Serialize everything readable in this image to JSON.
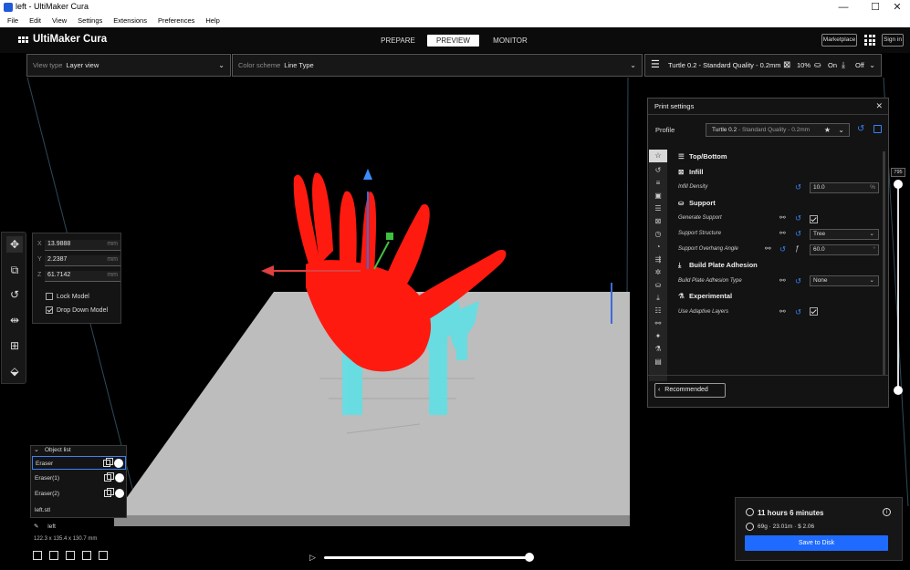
{
  "window": {
    "title": "left - UltiMaker Cura",
    "minimize": "—",
    "maximize": "☐",
    "close": "✕"
  },
  "menu": [
    "File",
    "Edit",
    "View",
    "Settings",
    "Extensions",
    "Preferences",
    "Help"
  ],
  "header": {
    "logo": "UltiMaker Cura",
    "stages": [
      "PREPARE",
      "PREVIEW",
      "MONITOR"
    ],
    "active_stage": "PREVIEW",
    "marketplace": "Marketplace",
    "signin": "Sign in"
  },
  "view_toolbar": {
    "view_type_label": "View type",
    "view_type_value": "Layer view",
    "color_scheme_label": "Color scheme",
    "color_scheme_value": "Line Type",
    "print_profile": "Turtle 0.2 - Standard Quality - 0.2mm",
    "infill": "10%",
    "support": "On",
    "adhesion": "Off"
  },
  "move_panel": {
    "x": {
      "axis": "X",
      "value": "13.9888",
      "unit": "mm"
    },
    "y": {
      "axis": "Y",
      "value": "2.2387",
      "unit": "mm"
    },
    "z": {
      "axis": "Z",
      "value": "61.7142",
      "unit": "mm"
    },
    "lock_model": "Lock Model",
    "drop_down_model": "Drop Down Model",
    "drop_down_checked": true
  },
  "print_settings": {
    "title": "Print settings",
    "profile_label": "Profile",
    "profile_name": "Turtle 0.2",
    "profile_quality": " - Standard Quality - 0.2mm",
    "sections": {
      "top_bottom": "Top/Bottom",
      "infill": "Infill",
      "support": "Support",
      "adhesion": "Build Plate Adhesion",
      "experimental": "Experimental"
    },
    "settings": {
      "infill_density": {
        "label": "Infill Density",
        "value": "10.0",
        "unit": "%"
      },
      "generate_support": {
        "label": "Generate Support",
        "checked": true
      },
      "support_structure": {
        "label": "Support Structure",
        "value": "Tree"
      },
      "overhang_angle": {
        "label": "Support Overhang Angle",
        "value": "60.0",
        "unit": "°"
      },
      "adhesion_type": {
        "label": "Build Plate Adhesion Type",
        "value": "None"
      },
      "adaptive_layers": {
        "label": "Use Adaptive Layers",
        "checked": true
      }
    },
    "recommended_button": "Recommended"
  },
  "layer_slider": {
    "current_layer": "795"
  },
  "object_list": {
    "title": "Object list",
    "items": [
      "Eraser",
      "Eraser(1)",
      "Eraser(2)"
    ],
    "selected": "Eraser",
    "file": "left.stl"
  },
  "selected_object": {
    "name": "left",
    "dimensions": "122.3 x 135.4 x 130.7 mm"
  },
  "simulation": {
    "progress": 1.0
  },
  "print_job": {
    "time": "11 hours 6 minutes",
    "cost": "69g · 23.01m · $ 2.06",
    "save_button": "Save to Disk"
  },
  "colors": {
    "accent": "#1f6bff",
    "model": "#ff1a10",
    "support": "#5fe0e6",
    "build_plate": "#bdbdbd"
  }
}
